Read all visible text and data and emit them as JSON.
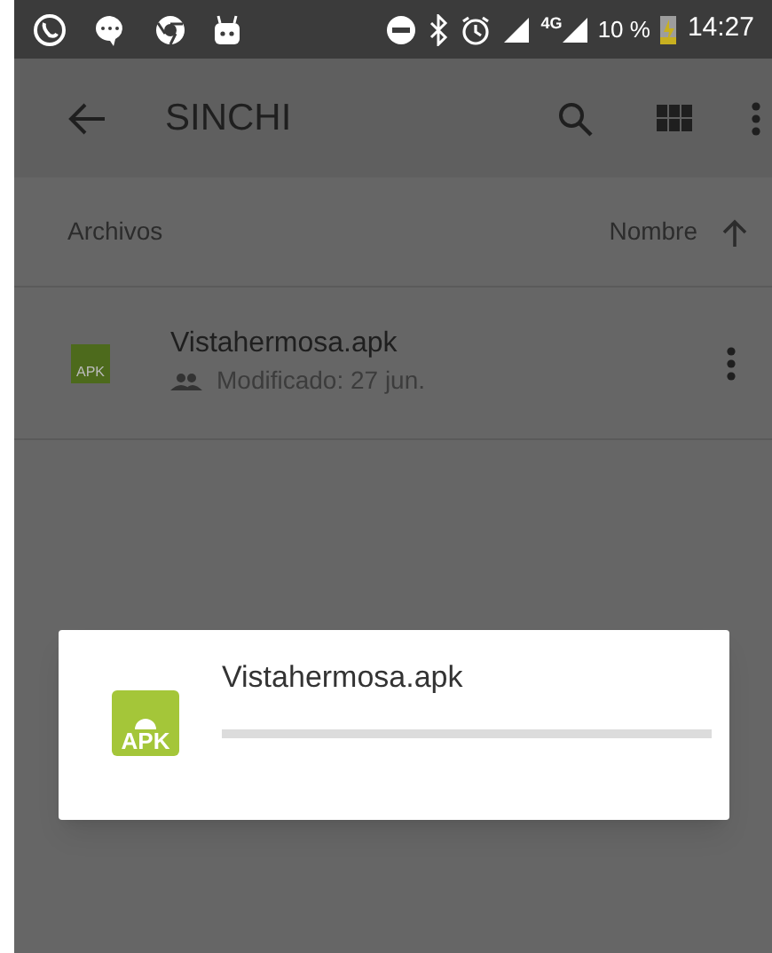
{
  "status_bar": {
    "network": "4G",
    "battery": "10 %",
    "time": "14:27"
  },
  "app_bar": {
    "title": "SINCHI"
  },
  "list_header": {
    "label": "Archivos",
    "sort": "Nombre"
  },
  "files": [
    {
      "name": "Vistahermosa.apk",
      "icon_text": "APK",
      "subtitle": "Modificado: 27 jun."
    }
  ],
  "dialog": {
    "icon_text": "APK",
    "file": "Vistahermosa.apk",
    "level": 0
  }
}
